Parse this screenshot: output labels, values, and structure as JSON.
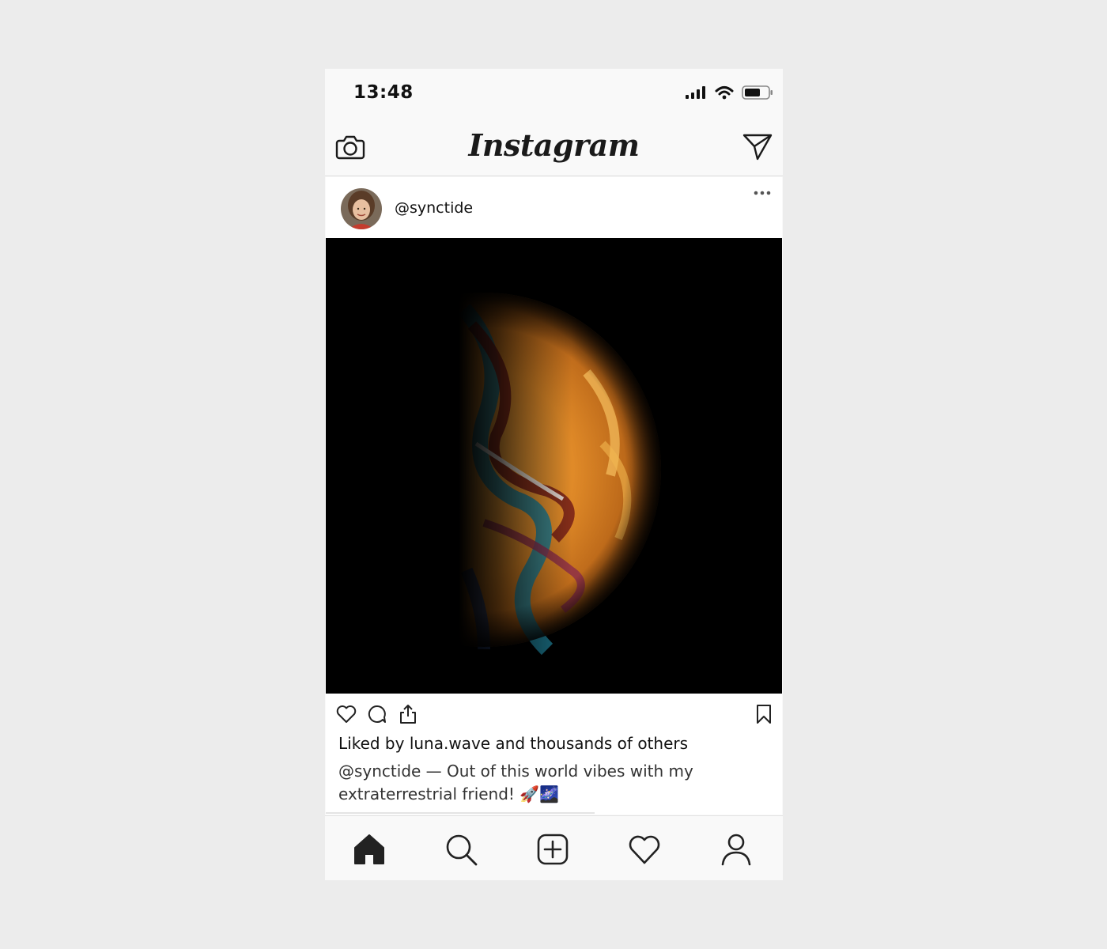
{
  "status_bar": {
    "time": "13:48",
    "icons": [
      "signal-icon",
      "wifi-icon",
      "battery-icon"
    ]
  },
  "top_nav": {
    "logo": "Instagram",
    "left_icon": "camera-icon",
    "right_icon": "send-icon"
  },
  "post": {
    "username": "@synctide",
    "more_icon": "more-options-icon",
    "image_subject": "planet-like soap bubble",
    "actions": [
      "heart-icon",
      "comment-icon",
      "share-icon"
    ],
    "save_icon": "bookmark-icon",
    "liked_by": "Liked by luna.wave and thousands of others",
    "caption_user": "@synctide",
    "caption_text": " — Out of this world vibes with my extraterrestrial friend! 🚀🌌"
  },
  "tab_bar": {
    "items": [
      "home-icon",
      "search-icon",
      "add-post-icon",
      "activity-heart-icon",
      "profile-icon"
    ]
  },
  "colors": {
    "background": "#ececec",
    "phone_bg": "#f9f9f9",
    "text": "#111111"
  }
}
